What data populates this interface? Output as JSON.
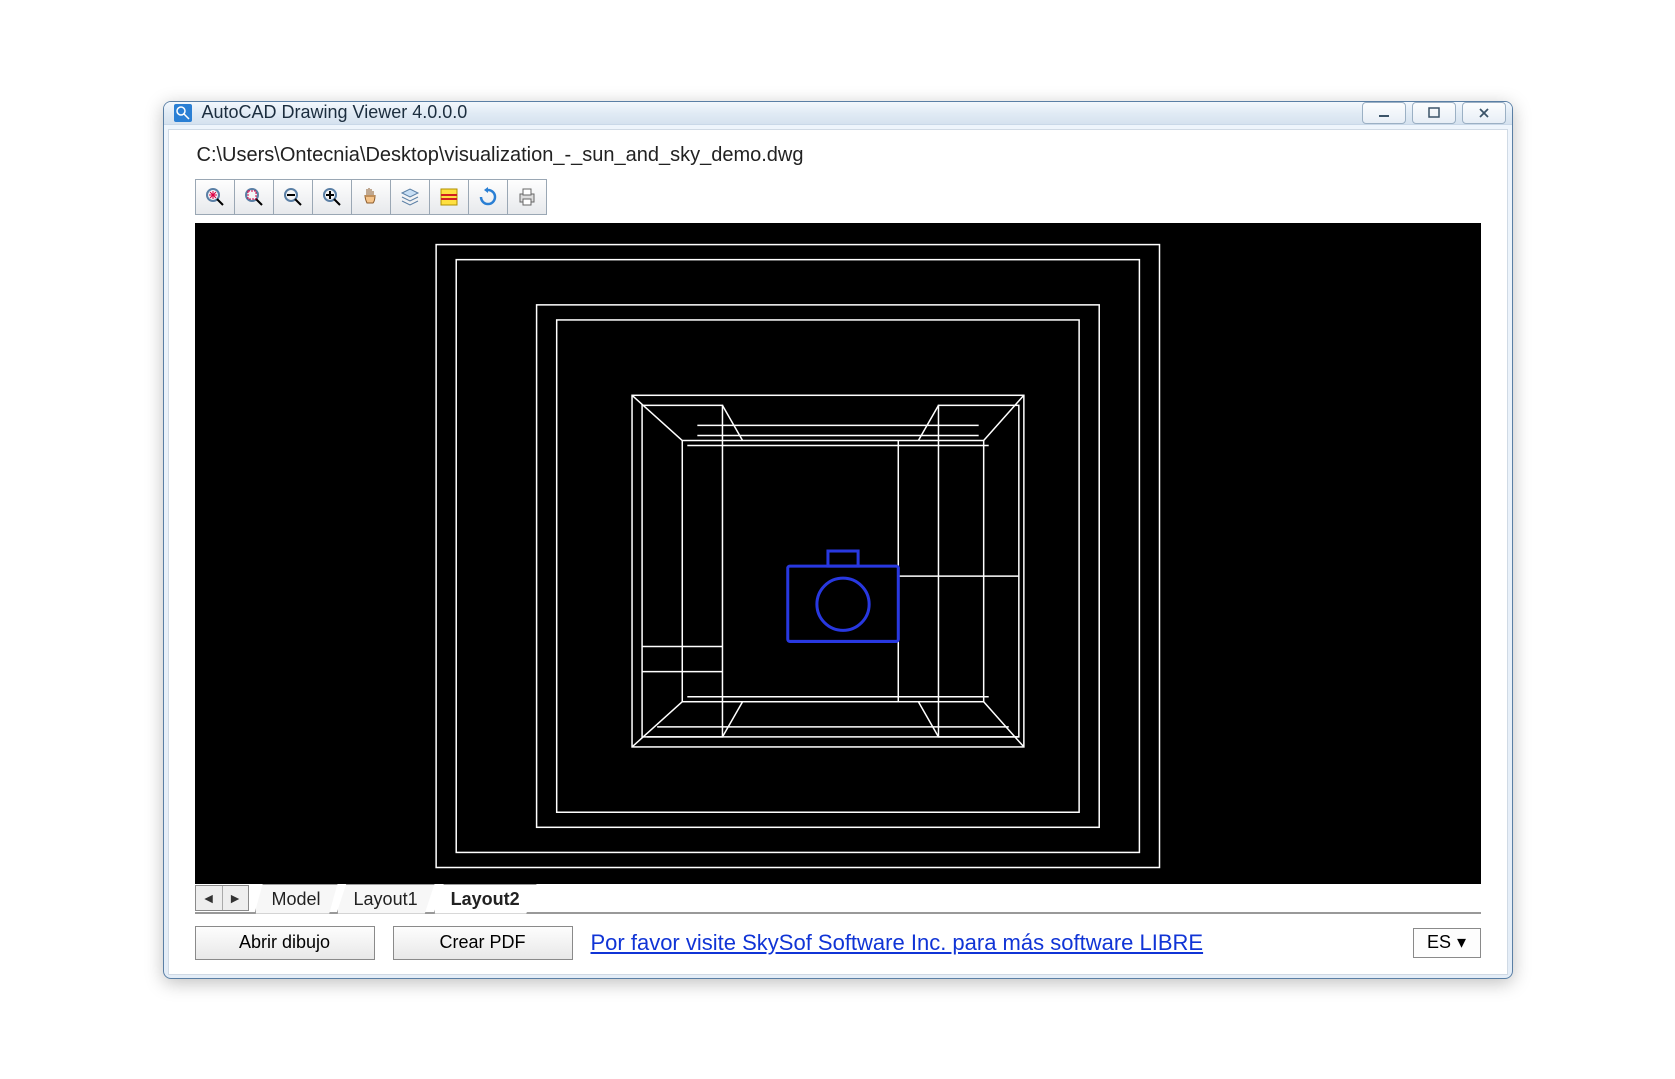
{
  "window": {
    "title": "AutoCAD Drawing Viewer 4.0.0.0"
  },
  "file": {
    "path": "C:\\Users\\Ontecnia\\Desktop\\visualization_-_sun_and_sky_demo.dwg"
  },
  "toolbar": {
    "icons": [
      "zoom-extents-icon",
      "zoom-window-icon",
      "zoom-out-icon",
      "zoom-in-icon",
      "pan-icon",
      "layers-icon",
      "properties-icon",
      "refresh-icon",
      "print-icon"
    ]
  },
  "tabs": {
    "items": [
      "Model",
      "Layout1",
      "Layout2"
    ],
    "active_index": 2
  },
  "buttons": {
    "open": "Abrir dibujo",
    "create_pdf": "Crear PDF"
  },
  "promo": {
    "link_text": "Por favor visite SkySof Software Inc. para más software LIBRE"
  },
  "language": {
    "selected": "ES"
  }
}
